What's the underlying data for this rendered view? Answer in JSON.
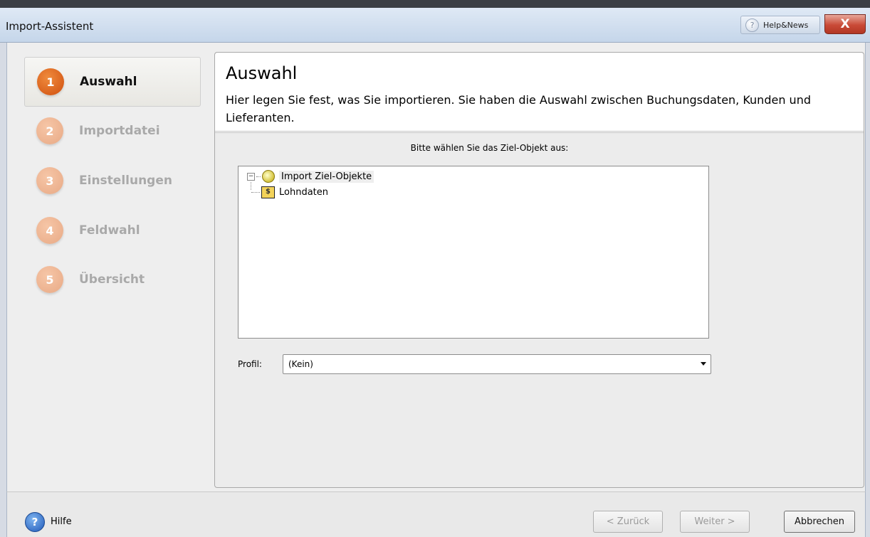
{
  "window": {
    "title": "Import-Assistent",
    "help_news_label": "Help&News",
    "close_glyph": "X"
  },
  "steps": [
    {
      "number": "1",
      "label": "Auswahl",
      "active": true
    },
    {
      "number": "2",
      "label": "Importdatei",
      "active": false
    },
    {
      "number": "3",
      "label": "Einstellungen",
      "active": false
    },
    {
      "number": "4",
      "label": "Feldwahl",
      "active": false
    },
    {
      "number": "5",
      "label": "Übersicht",
      "active": false
    }
  ],
  "header": {
    "title": "Auswahl",
    "description": "Hier legen Sie fest, was Sie importieren. Sie haben die Auswahl zwischen Buchungsdaten, Kunden und Lieferanten."
  },
  "main": {
    "prompt": "Bitte wählen Sie das Ziel-Objekt aus:",
    "tree": {
      "root": {
        "label": "Import Ziel-Objekte",
        "expander": "−"
      },
      "children": [
        {
          "label": "Lohndaten"
        }
      ]
    },
    "profile": {
      "label": "Profil:",
      "value": "(Kein)"
    }
  },
  "footer": {
    "help_label": "Hilfe",
    "back_label": "< Zurück",
    "next_label": "Weiter >",
    "cancel_label": "Abbrechen"
  }
}
